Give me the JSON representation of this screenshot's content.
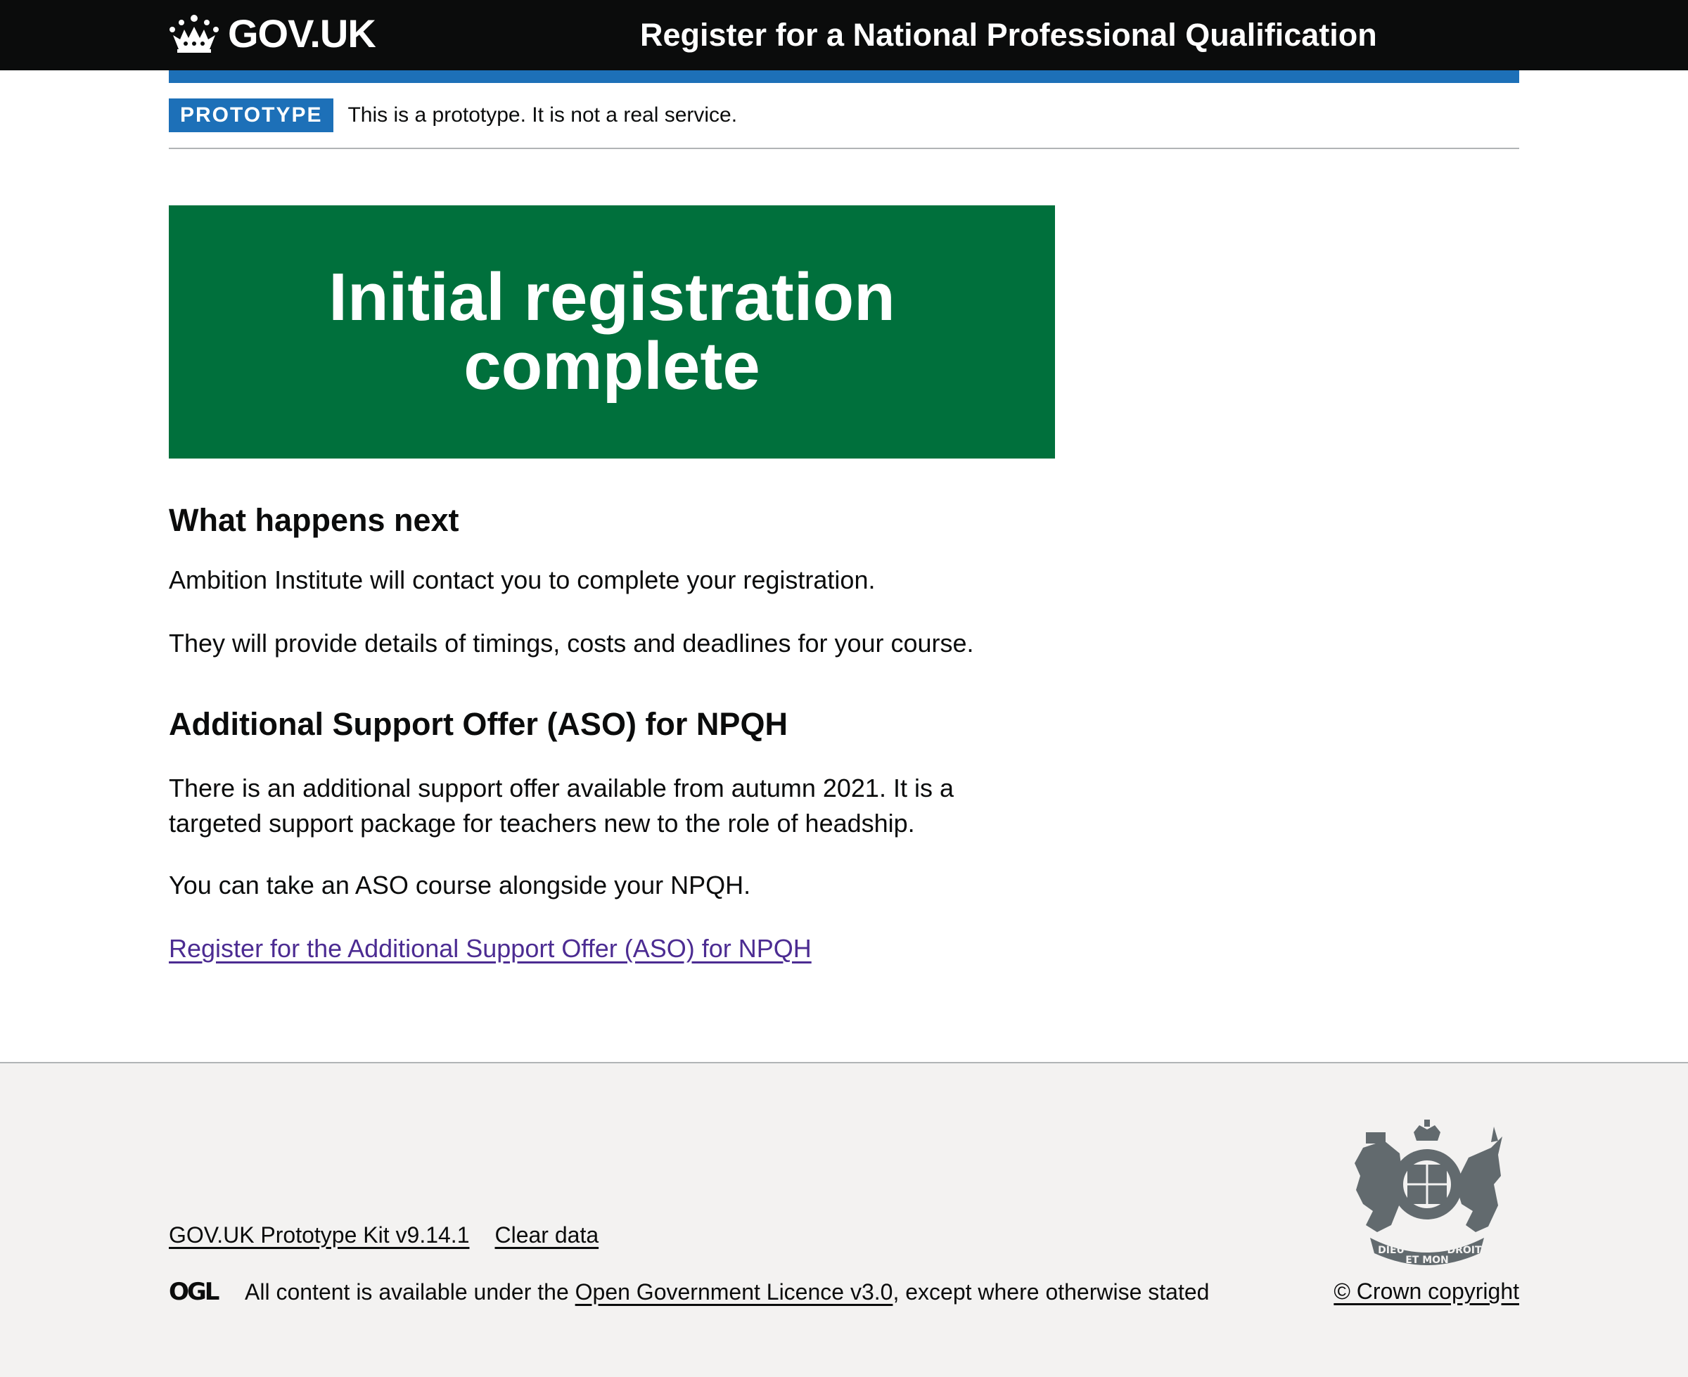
{
  "header": {
    "logo_text": "GOV.UK",
    "service_name": "Register for a National Professional Qualification"
  },
  "phase_banner": {
    "tag": "PROTOTYPE",
    "text": "This is a prototype. It is not a real service."
  },
  "panel": {
    "title": "Initial registration complete"
  },
  "content": {
    "next_heading": "What happens next",
    "next_p1": "Ambition Institute will contact you to complete your registration.",
    "next_p2": "They will provide details of timings, costs and deadlines for your course.",
    "aso_heading": "Additional Support Offer (ASO) for NPQH",
    "aso_p1": "There is an additional support offer available from autumn 2021. It is a targeted support package for teachers new to the role of headship.",
    "aso_p2": "You can take an ASO course alongside your NPQH.",
    "aso_link": "Register for the Additional Support Offer (ASO) for NPQH"
  },
  "footer": {
    "kit_link": "GOV.UK Prototype Kit v9.14.1",
    "clear_link": "Clear data",
    "ogl_logo_text": "OGL",
    "licence_prefix": "All content is available under the ",
    "licence_link": "Open Government Licence v3.0",
    "licence_suffix": ", except where otherwise stated",
    "crest_mottos": [
      "DIEU",
      "ET MON",
      "DROIT"
    ],
    "copyright": "© Crown copyright"
  },
  "colors": {
    "header_bg": "#0b0c0c",
    "brand_blue": "#1d70b8",
    "panel_green": "#00703c",
    "link_visited": "#4c2c92",
    "footer_bg": "#f3f2f1"
  }
}
